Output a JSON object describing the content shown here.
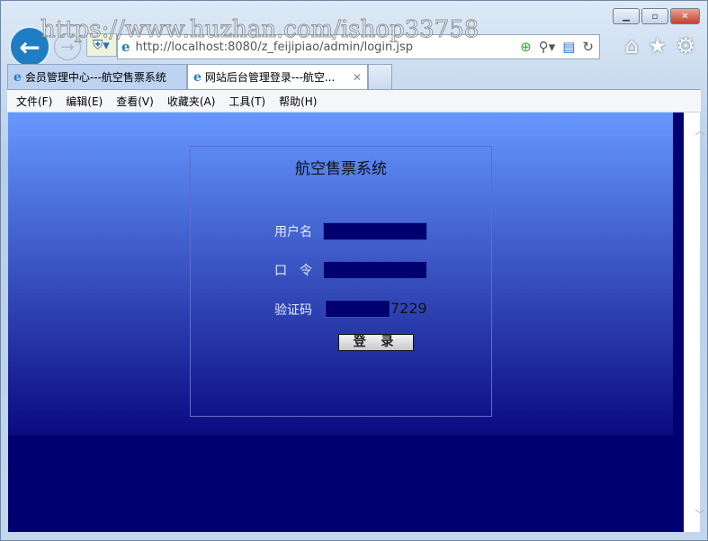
{
  "browser": {
    "url": "http://localhost:8080/z_feijipiao/admin/login.jsp",
    "tabs": [
      {
        "label": "会员管理中心---航空售票系统"
      },
      {
        "label": "网站后台管理登录---航空..."
      }
    ],
    "menu": [
      "文件(F)",
      "编辑(E)",
      "查看(V)",
      "收藏夹(A)",
      "工具(T)",
      "帮助(H)"
    ],
    "watermark": "https://www.huzhan.com/ishop33758"
  },
  "login": {
    "title": "航空售票系统",
    "username_label": "用户名",
    "password_label": "口　令",
    "captcha_label": "验证码",
    "captcha_code": "7229",
    "submit_label": "登 录",
    "username_value": "",
    "password_value": "",
    "captcha_value": ""
  }
}
